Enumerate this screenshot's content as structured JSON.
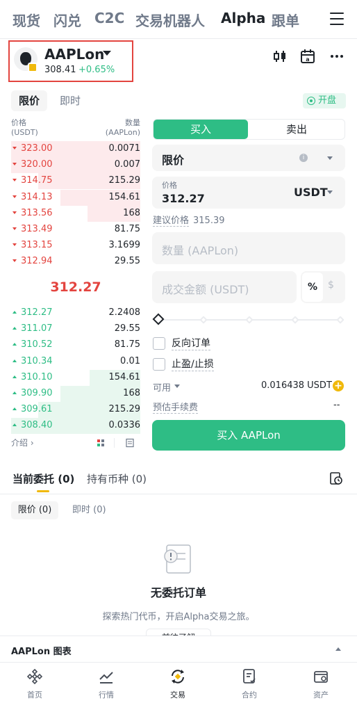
{
  "top_nav": [
    "现货",
    "闪兑",
    "C2C",
    "交易机器人",
    "Alpha",
    "跟单"
  ],
  "symbol": {
    "name": "AAPLon",
    "price": "308.41",
    "change": "+0.65%"
  },
  "order_tabs": {
    "limit": "限价",
    "market": "即时"
  },
  "market_status": "开盘",
  "orderbook": {
    "price_header": "价格",
    "price_unit": "(USDT)",
    "qty_header": "数量",
    "qty_unit": "(AAPLon)",
    "asks": [
      {
        "price": "323.00",
        "qty": "0.0071",
        "depth": 1.0
      },
      {
        "price": "320.00",
        "qty": "0.007",
        "depth": 1.0
      },
      {
        "price": "314.75",
        "qty": "215.29",
        "depth": 0.79
      },
      {
        "price": "314.13",
        "qty": "154.61",
        "depth": 0.62
      },
      {
        "price": "313.56",
        "qty": "168",
        "depth": 0.41
      },
      {
        "price": "313.49",
        "qty": "81.75",
        "depth": 0.0
      },
      {
        "price": "313.15",
        "qty": "3.1699",
        "depth": 0.0
      },
      {
        "price": "312.94",
        "qty": "29.55",
        "depth": 0.0
      }
    ],
    "mid_price": "312.27",
    "bids": [
      {
        "price": "312.27",
        "qty": "2.2408",
        "depth": 0.0
      },
      {
        "price": "311.07",
        "qty": "29.55",
        "depth": 0.0
      },
      {
        "price": "310.52",
        "qty": "81.75",
        "depth": 0.0
      },
      {
        "price": "310.34",
        "qty": "0.01",
        "depth": 0.0
      },
      {
        "price": "310.10",
        "qty": "154.61",
        "depth": 0.39
      },
      {
        "price": "309.90",
        "qty": "168",
        "depth": 0.62
      },
      {
        "price": "309.61",
        "qty": "215.29",
        "depth": 0.79
      },
      {
        "price": "308.40",
        "qty": "0.0336",
        "depth": 1.0
      }
    ],
    "intro_label": "介绍 ›"
  },
  "trade_form": {
    "buy_tab": "买入",
    "sell_tab": "卖出",
    "order_type": "限价",
    "price_label": "价格",
    "price_value": "312.27",
    "price_unit": "USDT",
    "suggest_label": "建议价格",
    "suggest_value": "315.39",
    "qty_placeholder": "数量 (AAPLon)",
    "amount_placeholder": "成交金额 (USDT)",
    "pct_label": "%",
    "dollar_label": "$",
    "reverse_order": "反向订单",
    "tp_sl": "止盈/止损",
    "available_label": "可用",
    "available_value": "0.016438 USDT",
    "fee_label": "预估手续费",
    "fee_value": "--",
    "buy_button": "买入 AAPLon"
  },
  "orders": {
    "tab_open": "当前委托 (0)",
    "tab_holdings": "持有币种 (0)",
    "sub_limit": "限价 (0)",
    "sub_market": "即时 (0)",
    "empty_title": "无委托订单",
    "empty_sub": "探索热门代币，开启Alpha交易之旅。",
    "go_button": "前往了解"
  },
  "chart_bar": "AAPLon 图表",
  "bottom_nav": [
    "首页",
    "行情",
    "交易",
    "合约",
    "资产"
  ],
  "colors": {
    "green": "#2ebd85",
    "red": "#e3443f",
    "yellow": "#f0b90b"
  }
}
